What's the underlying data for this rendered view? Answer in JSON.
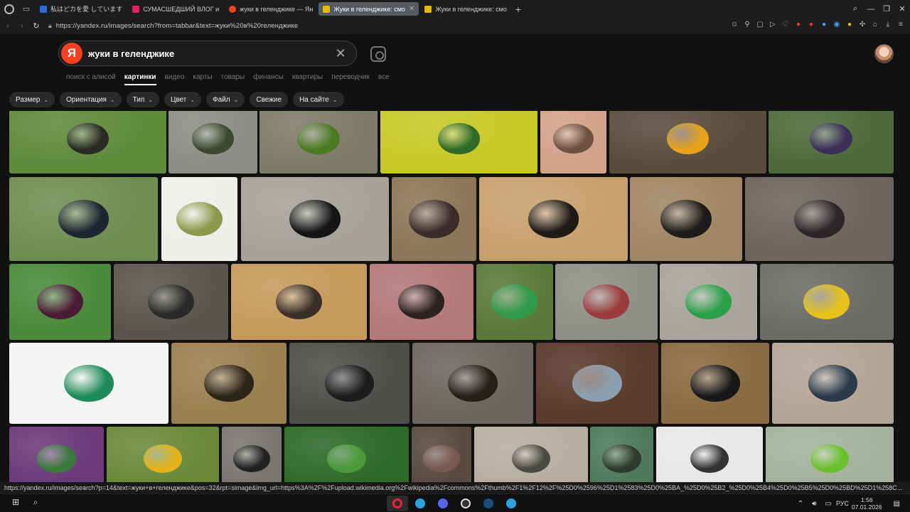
{
  "browser": {
    "tabs": [
      {
        "label": "私はどカを愛 しています",
        "color": "#2d6bd6",
        "active": false
      },
      {
        "label": "СУМАСШЕДШИЙ ВЛОГ и",
        "color": "#e0245e",
        "active": false
      },
      {
        "label": "жуки в геленджике — Ян",
        "color": "#fc3f1d",
        "active": false
      },
      {
        "label": "Жуки в геленджике: смо",
        "color": "#e6b800",
        "active": true
      },
      {
        "label": "Жуки в геленджике: смо",
        "color": "#e6b800",
        "active": false
      }
    ],
    "new_tab": "+",
    "url": "https://yandex.ru/images/search?from=tabbar&text=жуки%20в%20геленджике"
  },
  "search": {
    "logo": "Я",
    "query": "жуки в геленджике"
  },
  "services": [
    {
      "label": "поиск с алисой",
      "selected": false
    },
    {
      "label": "картинки",
      "selected": true
    },
    {
      "label": "видео",
      "selected": false
    },
    {
      "label": "карты",
      "selected": false
    },
    {
      "label": "товары",
      "selected": false
    },
    {
      "label": "финансы",
      "selected": false
    },
    {
      "label": "квартиры",
      "selected": false
    },
    {
      "label": "переводчик",
      "selected": false
    },
    {
      "label": "все",
      "selected": false
    }
  ],
  "filters": [
    {
      "label": "Размер",
      "dropdown": true
    },
    {
      "label": "Ориентация",
      "dropdown": true
    },
    {
      "label": "Тип",
      "dropdown": true
    },
    {
      "label": "Цвет",
      "dropdown": true
    },
    {
      "label": "Файл",
      "dropdown": true
    },
    {
      "label": "Свежие",
      "dropdown": false
    },
    {
      "label": "На сайте",
      "dropdown": true
    }
  ],
  "status_url": "https://yandex.ru/images/search?p=14&text=жуки+в+геленджике&pos=32&rpt=simage&img_url=https%3A%2F%2Fupload.wikimedia.org%2Fwikipedia%2Fcommons%2Fthumb%2F1%2F12%2F%25D0%2596%25D1%2583%25D0%25BA_%25D0%25B2_%25D0%25B4%25D0%25B5%25D0%25BD%25D1%258C...",
  "taskbar": {
    "language": "РУС",
    "time": "1:56",
    "date": "07.01.2026"
  },
  "images": [
    {
      "id": "img-1",
      "bg": "#5f8a3a",
      "bug": "#2a2a24"
    },
    {
      "id": "img-2",
      "bg": "#8b8d86",
      "bug": "#3b4a2e"
    },
    {
      "id": "img-3",
      "bg": "#7d7c68",
      "bug": "#4a7a22"
    },
    {
      "id": "img-4",
      "bg": "#c7c925",
      "bug": "#2f6a2a"
    },
    {
      "id": "img-5",
      "bg": "#d3a28a",
      "bug": "#6e5040"
    },
    {
      "id": "img-6",
      "bg": "#5a4b3c",
      "bug": "#e8a21a"
    },
    {
      "id": "img-7",
      "bg": "#4d6a3a",
      "bug": "#3b2f5a"
    },
    {
      "id": "img-8",
      "bg": "#6f8e52",
      "bug": "#1f2530"
    },
    {
      "id": "img-9",
      "bg": "#eeeeea",
      "bug": "#8a9a4a"
    },
    {
      "id": "img-10",
      "bg": "#a6a29a",
      "bug": "#151515"
    },
    {
      "id": "img-11",
      "bg": "#8d7658",
      "bug": "#3a2c2a"
    },
    {
      "id": "img-12",
      "bg": "#c8a06e",
      "bug": "#1d1a18"
    },
    {
      "id": "img-13",
      "bg": "#a08664",
      "bug": "#1e1c1a"
    },
    {
      "id": "img-14",
      "bg": "#6d655c",
      "bug": "#2c2628"
    },
    {
      "id": "img-15",
      "bg": "#4b8a3a",
      "bug": "#4a1a36"
    },
    {
      "id": "img-16",
      "bg": "#5a554e",
      "bug": "#2a2a28"
    },
    {
      "id": "img-17",
      "bg": "#c59a5a",
      "bug": "#3a2e28"
    },
    {
      "id": "img-18",
      "bg": "#b47878",
      "bug": "#2b2222"
    },
    {
      "id": "img-19",
      "bg": "#5a7a3a",
      "bug": "#2f9a4a"
    },
    {
      "id": "img-20",
      "bg": "#8f8f87",
      "bug": "#9a3a3a"
    },
    {
      "id": "img-21",
      "bg": "#a8a39b",
      "bug": "#2aa04a"
    },
    {
      "id": "img-22",
      "bg": "#6d6b66",
      "bug": "#e6c21a"
    },
    {
      "id": "img-23",
      "bg": "#f4f4f2",
      "bug": "#1e8a5a"
    },
    {
      "id": "img-24",
      "bg": "#9a8050",
      "bug": "#2e2418"
    },
    {
      "id": "img-25",
      "bg": "#4e4e4a",
      "bug": "#1c1c1c"
    },
    {
      "id": "img-26",
      "bg": "#6c6660",
      "bug": "#222018"
    },
    {
      "id": "img-27",
      "bg": "#5a3a2c",
      "bug": "#8aa0b0"
    },
    {
      "id": "img-28",
      "bg": "#8a6a40",
      "bug": "#181818"
    },
    {
      "id": "img-29",
      "bg": "#b4a496",
      "bug": "#2a3a4a"
    },
    {
      "id": "img-30",
      "bg": "#6c3a7a",
      "bug": "#3a7a3a"
    },
    {
      "id": "img-31",
      "bg": "#6a8a3a",
      "bug": "#e6b21a"
    },
    {
      "id": "img-32",
      "bg": "#7a7670",
      "bug": "#222"
    },
    {
      "id": "img-33",
      "bg": "#2e6a2a",
      "bug": "#4a9a3a"
    },
    {
      "id": "img-34",
      "bg": "#5a4a40",
      "bug": "#7a5a50"
    },
    {
      "id": "img-35",
      "bg": "#b8aea0",
      "bug": "#4a4a42"
    },
    {
      "id": "img-36",
      "bg": "#4e7a5a",
      "bug": "#2e3a2e"
    },
    {
      "id": "img-37",
      "bg": "#e8e8e6",
      "bug": "#333"
    },
    {
      "id": "img-38",
      "bg": "#a4b29c",
      "bug": "#6ac02a"
    }
  ]
}
